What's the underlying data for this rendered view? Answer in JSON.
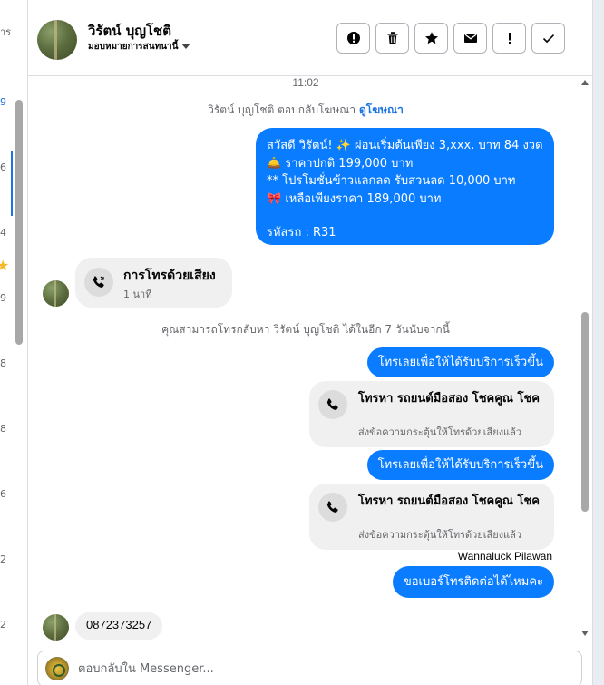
{
  "sidebar_fragments": [
    "าร",
    "9",
    "6",
    "4",
    "9",
    "8",
    "8",
    "6",
    "2",
    "2"
  ],
  "header": {
    "name": "วิรัตน์ บุญโชติ",
    "assign_label": "มอบหมายการสนทนานี้"
  },
  "toolbar": {
    "buttons": [
      "report-icon",
      "trash-icon",
      "star-icon",
      "mail-icon",
      "exclamation-icon",
      "check-icon"
    ]
  },
  "chat": {
    "timestamp": "11:02",
    "ad_reply_text": "วิรัตน์ บุญโชติ ตอบกลับโฆษณา",
    "ad_reply_link": "ดูโฆษณา",
    "promo_lines": [
      "สวัสดี วิรัตน์! ✨  ผ่อนเริ่มต้นเพียง 3,xxx. บาท 84 งวด",
      "🛎️ ราคาปกติ 199,000 บาท",
      "** โปรโมชั่นข้าวแลกลด รับส่วนลด 10,000 บาท",
      "🎀  เหลือเพียงราคา 189,000 บาท",
      "",
      "รหัสรถ : R31"
    ],
    "voice_call": {
      "title": "การโทรด้วยเสียง",
      "duration": "1 นาที"
    },
    "callback_notice": "คุณสามารถโทรกลับหา วิรัตน์ บุญโชติ ได้ในอีก 7 วันนับจากนี้",
    "call_prompt_1": "โทรเลยเพื่อให้ได้รับบริการเร็วขึ้น",
    "call_card_1": {
      "title": "โทรหา รถยนต์มือสอง โชคคูณ โชค",
      "sub": "ส่งข้อความกระตุ้นให้โทรด้วยเสียงแล้ว"
    },
    "call_prompt_2": "โทรเลยเพื่อให้ได้รับบริการเร็วขึ้น",
    "call_card_2": {
      "title": "โทรหา รถยนต์มือสอง โชคคูณ โชค",
      "sub": "ส่งข้อความกระตุ้นให้โทรด้วยเสียงแล้ว"
    },
    "sender_name": "Wannaluck Pilawan",
    "ask_phone": "ขอเบอร์โทรติดต่อได้ไหมคะ",
    "customer_phone": "0872373257"
  },
  "composer": {
    "placeholder": "ตอบกลับใน Messenger..."
  },
  "colors": {
    "accent": "#0a7cff",
    "link": "#1b74e4"
  }
}
